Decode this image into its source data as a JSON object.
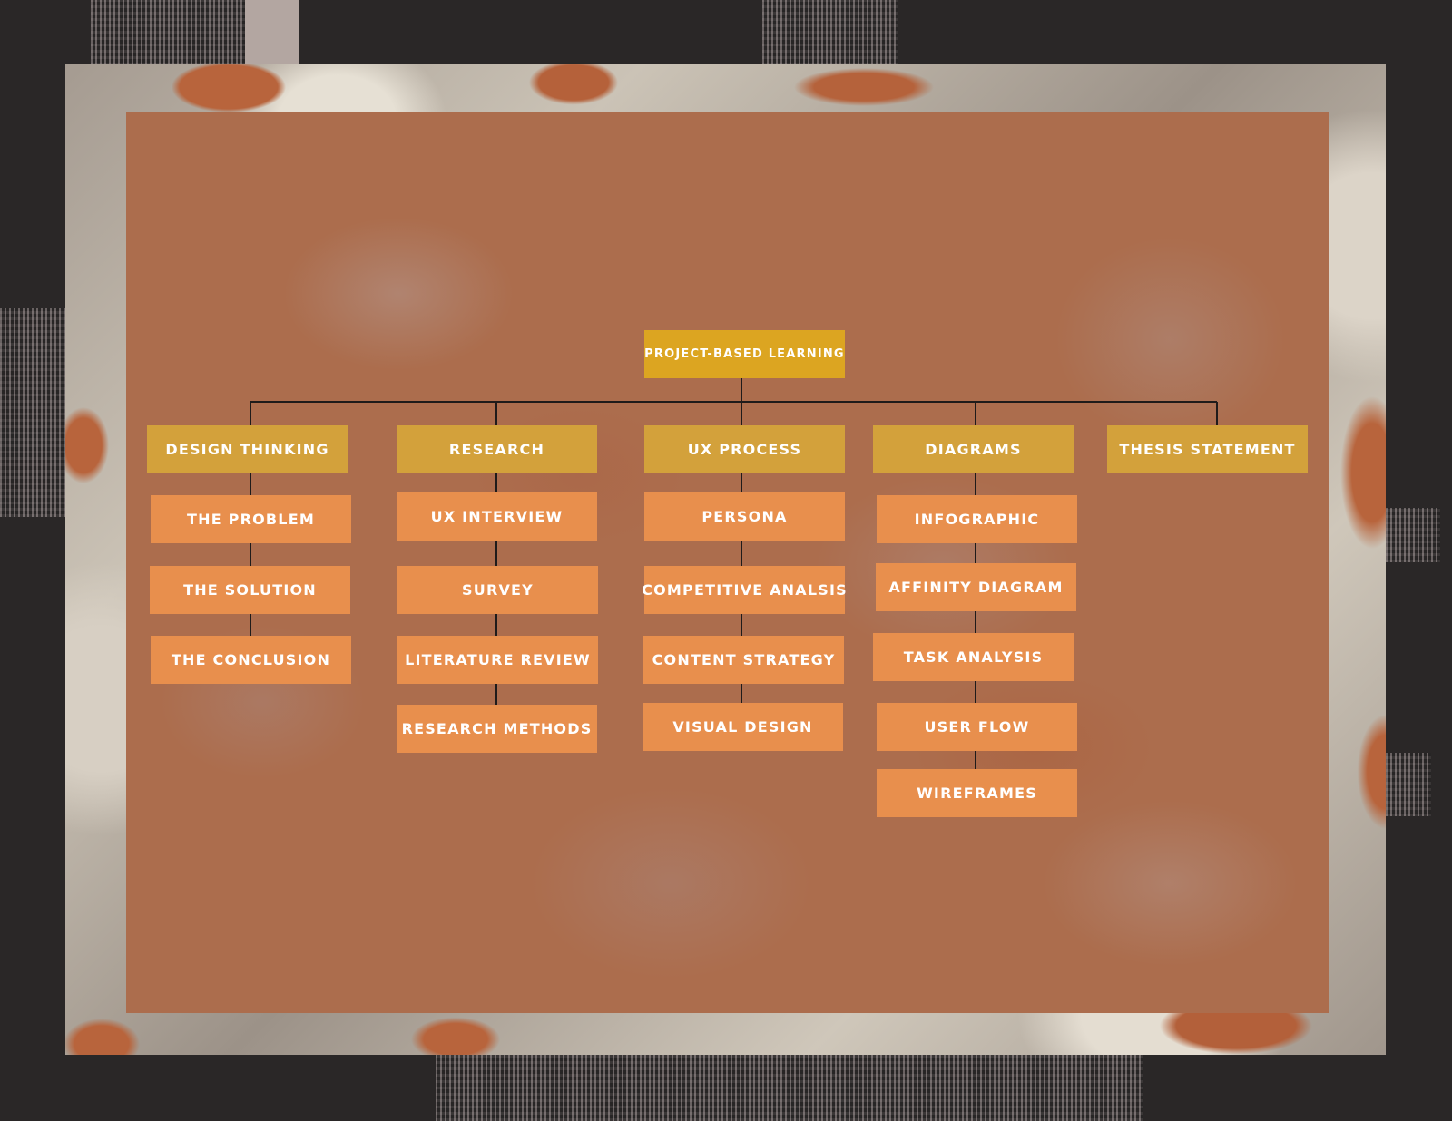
{
  "diagram": {
    "root": "PROJECT-BASED LEARNING",
    "categories": [
      {
        "label": "DESIGN THINKING",
        "items": [
          "THE PROBLEM",
          "THE SOLUTION",
          "THE CONCLUSION"
        ]
      },
      {
        "label": "RESEARCH",
        "items": [
          "UX INTERVIEW",
          "SURVEY",
          "LITERATURE REVIEW",
          "RESEARCH METHODS"
        ]
      },
      {
        "label": "UX PROCESS",
        "items": [
          "PERSONA",
          "COMPETITIVE ANALSIS",
          "CONTENT STRATEGY",
          "VISUAL DESIGN"
        ]
      },
      {
        "label": "DIAGRAMS",
        "items": [
          "INFOGRAPHIC",
          "AFFINITY DIAGRAM",
          "TASK ANALYSIS",
          "USER FLOW",
          "WIREFRAMES"
        ]
      },
      {
        "label": "THESIS STATEMENT",
        "items": []
      }
    ]
  },
  "colors": {
    "root_box": "#dca521",
    "category_box": "#d3a13b",
    "item_box": "#e88f4d",
    "panel": "#ac6d4d",
    "connector": "#1f1b1a",
    "background": "#2a2727"
  }
}
